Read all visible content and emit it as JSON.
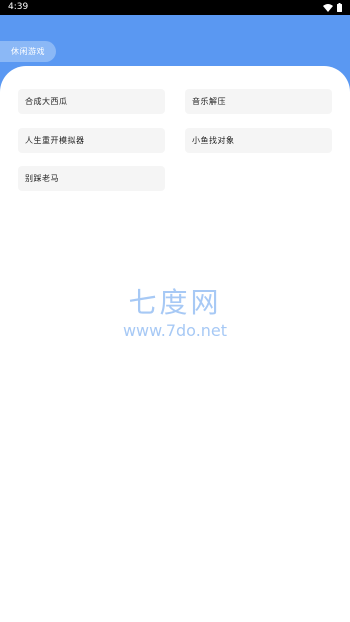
{
  "statusbar": {
    "time": "4:39"
  },
  "header": {
    "category": "休闲游戏"
  },
  "games": [
    {
      "label": "合成大西瓜"
    },
    {
      "label": "音乐解压"
    },
    {
      "label": "人生重开模拟器"
    },
    {
      "label": "小鱼找对象"
    },
    {
      "label": "别踩老马"
    }
  ],
  "watermark": {
    "title": "七度网",
    "url": "www.7do.net"
  },
  "colors": {
    "header_bg": "#5a98f2",
    "pill_bg": "#8bb8f6",
    "item_bg": "#f5f5f5",
    "watermark": "#a7c9f5"
  },
  "icons": [
    "wifi-icon",
    "battery-icon"
  ]
}
